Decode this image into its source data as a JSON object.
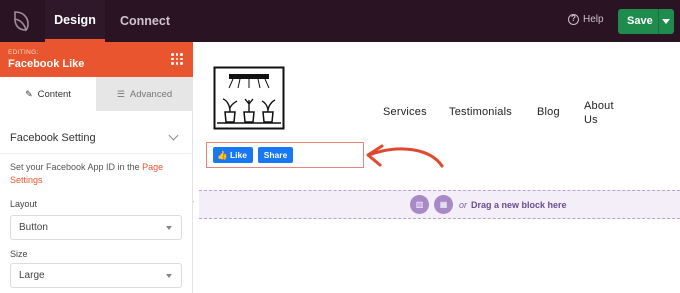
{
  "topbar": {
    "tabs": [
      {
        "label": "Design"
      },
      {
        "label": "Connect"
      }
    ],
    "help_label": "Help",
    "help_icon": "?",
    "save_label": "Save",
    "accent_color": "#e8552e",
    "save_color": "#1f8c4e"
  },
  "sidebar": {
    "editing_label": "EDITING:",
    "editing_title": "Facebook Like",
    "tabs": [
      {
        "label": "Content",
        "icon": "pencil-icon"
      },
      {
        "label": "Advanced",
        "icon": "sliders-icon"
      }
    ],
    "section_title": "Facebook Setting",
    "help_text_before": "Set your Facebook App ID in the ",
    "help_text_link": "Page Settings",
    "fields": [
      {
        "label": "Layout",
        "value": "Button"
      },
      {
        "label": "Size",
        "value": "Large"
      }
    ]
  },
  "canvas": {
    "nav": [
      "Services",
      "Testimonials",
      "Blog",
      "About Us"
    ],
    "fb_like_label": "Like",
    "fb_share_label": "Share",
    "fb_color": "#1877f2",
    "drop_or": "or",
    "drop_text": "Drag a new block here"
  }
}
